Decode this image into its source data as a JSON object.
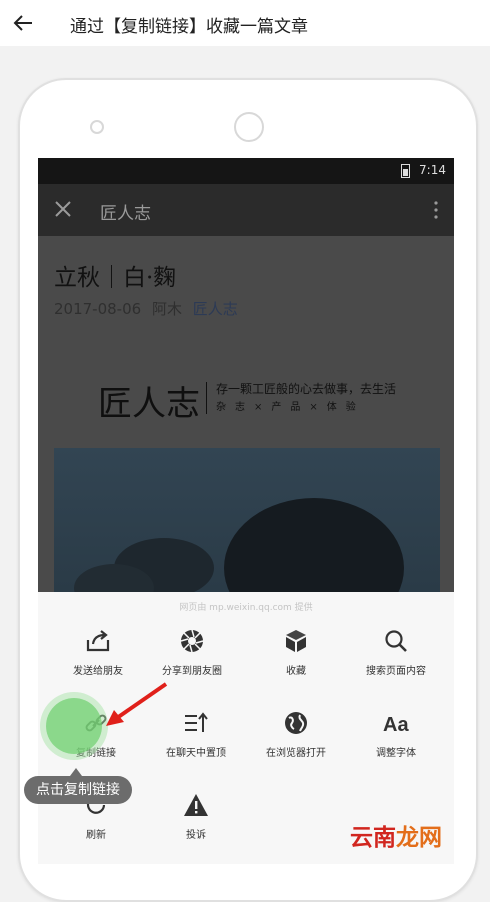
{
  "header": {
    "title": "通过【复制链接】收藏一篇文章",
    "back_icon": "arrow-left-icon"
  },
  "phone": {
    "status": {
      "time": "7:14"
    },
    "appbar": {
      "title": "匠人志"
    },
    "article": {
      "title": "立秋｜白·麴",
      "date": "2017-08-06",
      "author": "阿木",
      "account": "匠人志",
      "logo_text": "匠人志",
      "logo_slogan": "存一颗工匠般的心去做事，去生活",
      "logo_sub": "杂志×产品×体验"
    },
    "sheet": {
      "provider": "网页由 mp.weixin.qq.com 提供",
      "items": [
        {
          "label": "发送给朋友",
          "icon": "share-icon"
        },
        {
          "label": "分享到朋友圈",
          "icon": "aperture-icon"
        },
        {
          "label": "收藏",
          "icon": "cube-icon"
        },
        {
          "label": "搜索页面内容",
          "icon": "search-icon"
        },
        {
          "label": "复制链接",
          "icon": "link-icon"
        },
        {
          "label": "在聊天中置顶",
          "icon": "pin-top-icon"
        },
        {
          "label": "在浏览器打开",
          "icon": "globe-icon"
        },
        {
          "label": "调整字体",
          "icon": "font-icon"
        },
        {
          "label": "刷新",
          "icon": "refresh-icon"
        },
        {
          "label": "投诉",
          "icon": "warning-icon"
        }
      ]
    }
  },
  "tooltip": "点击复制链接",
  "watermark": {
    "part1": "云南",
    "part2": "龙网"
  },
  "colors": {
    "accent_green": "#78d278",
    "arrow_red": "#e0201a"
  }
}
